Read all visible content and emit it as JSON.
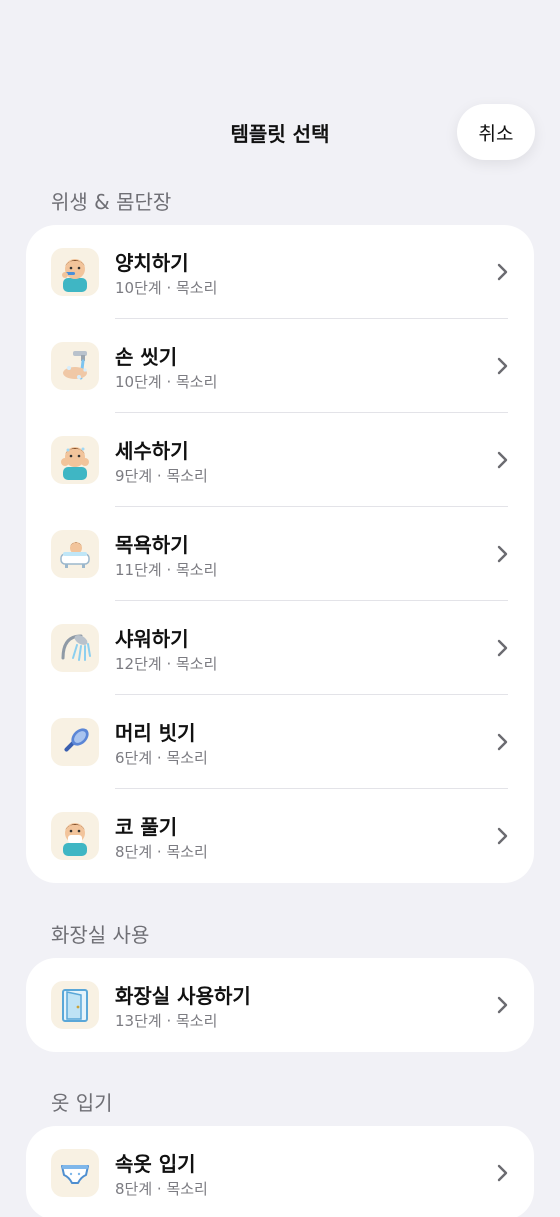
{
  "header": {
    "title": "템플릿 선택",
    "cancel_label": "취소"
  },
  "sections": [
    {
      "title": "위생 & 몸단장",
      "items": [
        {
          "name": "양치하기",
          "meta": "10단계 · 목소리",
          "icon": "child-brushing-teeth-icon"
        },
        {
          "name": "손 씻기",
          "meta": "10단계 · 목소리",
          "icon": "hand-washing-icon"
        },
        {
          "name": "세수하기",
          "meta": "9단계 · 목소리",
          "icon": "child-washing-face-icon"
        },
        {
          "name": "목욕하기",
          "meta": "11단계 · 목소리",
          "icon": "bathtub-icon"
        },
        {
          "name": "샤워하기",
          "meta": "12단계 · 목소리",
          "icon": "shower-head-icon"
        },
        {
          "name": "머리 빗기",
          "meta": "6단계 · 목소리",
          "icon": "hairbrush-icon"
        },
        {
          "name": "코 풀기",
          "meta": "8단계 · 목소리",
          "icon": "child-blowing-nose-icon"
        }
      ]
    },
    {
      "title": "화장실 사용",
      "items": [
        {
          "name": "화장실 사용하기",
          "meta": "13단계 · 목소리",
          "icon": "bathroom-door-icon"
        }
      ]
    },
    {
      "title": "옷 입기",
      "items": [
        {
          "name": "속옷 입기",
          "meta": "8단계 · 목소리",
          "icon": "underwear-icon"
        }
      ]
    }
  ],
  "colors": {
    "background": "#f1f1f6",
    "card": "#ffffff",
    "thumb_bg": "#f8f1e3",
    "secondary_text": "#7c7c82",
    "section_title": "#6f6f75",
    "chevron": "#6b6b70"
  }
}
